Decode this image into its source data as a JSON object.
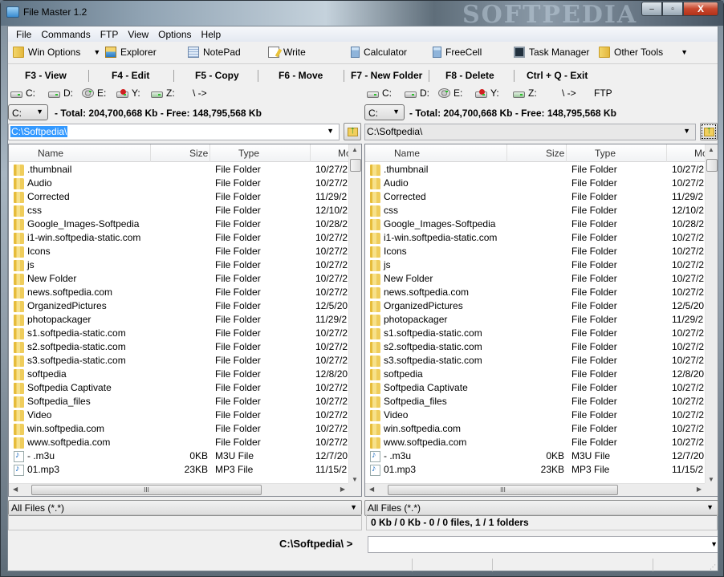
{
  "window": {
    "title": "File Master 1.2",
    "watermark": "SOFTPEDIA",
    "controls": {
      "minimize": "–",
      "maximize": "▫",
      "close": "X"
    }
  },
  "menu": [
    "File",
    "Commands",
    "FTP",
    "View",
    "Options",
    "Help"
  ],
  "toolbar": [
    {
      "label": "Win Options",
      "icon": "folder-icon",
      "dropdown": true
    },
    {
      "label": "Explorer",
      "icon": "explorer-icon"
    },
    {
      "label": "NotePad",
      "icon": "notepad-icon"
    },
    {
      "label": "Write",
      "icon": "write-icon"
    },
    {
      "label": "Calculator",
      "icon": "calculator-icon"
    },
    {
      "label": "FreeCell",
      "icon": "freecell-icon"
    },
    {
      "label": "Task Manager",
      "icon": "task-manager-icon"
    },
    {
      "label": "Other Tools",
      "icon": "folder-icon",
      "dropdown": true
    }
  ],
  "function_keys": [
    "F3 - View",
    "F4 - Edit",
    "F5 - Copy",
    "F6 - Move",
    "F7 - New Folder",
    "F8 - Delete",
    "Ctrl + Q - Exit"
  ],
  "dropdown_arrow": "▼",
  "panels": {
    "left": {
      "drives": [
        "C:",
        "D:",
        "E:",
        "Y:",
        "Z:",
        "\\ ->"
      ],
      "selected_drive": "C:",
      "disk_info": "- Total: 204,700,668 Kb - Free: 148,795,568 Kb",
      "path": "C:\\Softpedia\\",
      "filter": "All Files (*.*)"
    },
    "right": {
      "drives": [
        "C:",
        "D:",
        "E:",
        "Y:",
        "Z:",
        "\\ ->",
        "FTP"
      ],
      "selected_drive": "C:",
      "disk_info": "- Total: 204,700,668 Kb - Free: 148,795,568 Kb",
      "path": "C:\\Softpedia\\",
      "filter": "All Files (*.*)"
    }
  },
  "columns": [
    "Name",
    "Size",
    "Type",
    "Mo"
  ],
  "files": [
    {
      "name": ".thumbnail",
      "size": "",
      "type": "File Folder",
      "modified": "10/27/2",
      "kind": "folder"
    },
    {
      "name": "Audio",
      "size": "",
      "type": "File Folder",
      "modified": "10/27/2",
      "kind": "folder"
    },
    {
      "name": "Corrected",
      "size": "",
      "type": "File Folder",
      "modified": "11/29/2",
      "kind": "folder"
    },
    {
      "name": "css",
      "size": "",
      "type": "File Folder",
      "modified": "12/10/2",
      "kind": "folder"
    },
    {
      "name": "Google_Images-Softpedia",
      "size": "",
      "type": "File Folder",
      "modified": "10/28/2",
      "kind": "folder"
    },
    {
      "name": "i1-win.softpedia-static.com",
      "size": "",
      "type": "File Folder",
      "modified": "10/27/2",
      "kind": "folder"
    },
    {
      "name": "Icons",
      "size": "",
      "type": "File Folder",
      "modified": "10/27/2",
      "kind": "folder"
    },
    {
      "name": "js",
      "size": "",
      "type": "File Folder",
      "modified": "10/27/2",
      "kind": "folder"
    },
    {
      "name": "New Folder",
      "size": "",
      "type": "File Folder",
      "modified": "10/27/2",
      "kind": "folder"
    },
    {
      "name": "news.softpedia.com",
      "size": "",
      "type": "File Folder",
      "modified": "10/27/2",
      "kind": "folder"
    },
    {
      "name": "OrganizedPictures",
      "size": "",
      "type": "File Folder",
      "modified": "12/5/20",
      "kind": "folder"
    },
    {
      "name": "photopackager",
      "size": "",
      "type": "File Folder",
      "modified": "11/29/2",
      "kind": "folder"
    },
    {
      "name": "s1.softpedia-static.com",
      "size": "",
      "type": "File Folder",
      "modified": "10/27/2",
      "kind": "folder"
    },
    {
      "name": "s2.softpedia-static.com",
      "size": "",
      "type": "File Folder",
      "modified": "10/27/2",
      "kind": "folder"
    },
    {
      "name": "s3.softpedia-static.com",
      "size": "",
      "type": "File Folder",
      "modified": "10/27/2",
      "kind": "folder"
    },
    {
      "name": "softpedia",
      "size": "",
      "type": "File Folder",
      "modified": "12/8/20",
      "kind": "folder"
    },
    {
      "name": "Softpedia Captivate",
      "size": "",
      "type": "File Folder",
      "modified": "10/27/2",
      "kind": "folder"
    },
    {
      "name": "Softpedia_files",
      "size": "",
      "type": "File Folder",
      "modified": "10/27/2",
      "kind": "folder"
    },
    {
      "name": "Video",
      "size": "",
      "type": "File Folder",
      "modified": "10/27/2",
      "kind": "folder"
    },
    {
      "name": "win.softpedia.com",
      "size": "",
      "type": "File Folder",
      "modified": "10/27/2",
      "kind": "folder"
    },
    {
      "name": "www.softpedia.com",
      "size": "",
      "type": "File Folder",
      "modified": "10/27/2",
      "kind": "folder"
    },
    {
      "name": " - .m3u",
      "size": "0KB",
      "type": "M3U File",
      "modified": "12/7/20",
      "kind": "audio"
    },
    {
      "name": "01.mp3",
      "size": "23KB",
      "type": "MP3 File",
      "modified": "11/15/2",
      "kind": "audio"
    }
  ],
  "hscroll_grip": "III",
  "status": {
    "selection": "0 Kb / 0 Kb - 0 / 0 files, 1 / 1 folders",
    "command_prompt": "C:\\Softpedia\\ >",
    "command_value": ""
  }
}
